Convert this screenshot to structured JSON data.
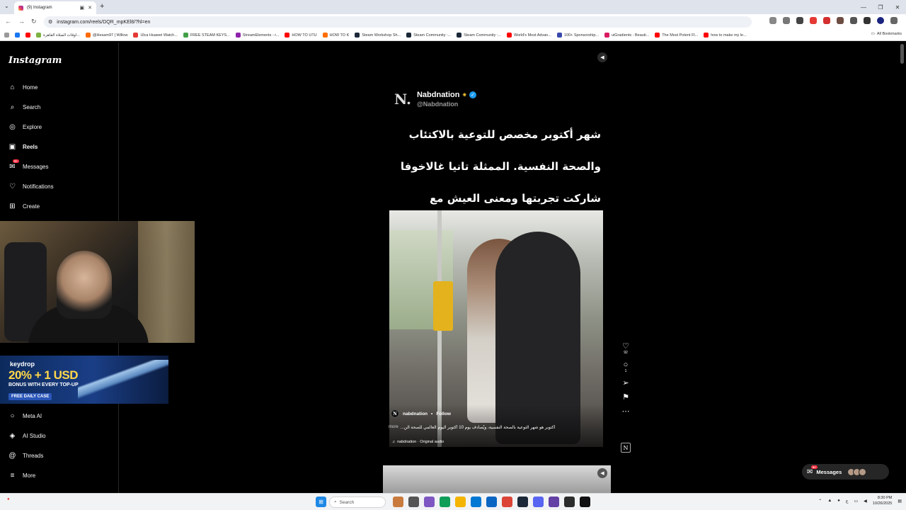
{
  "browser": {
    "tab_title": "(9) Instagram",
    "url": "instagram.com/reels/DQR_mpKEl8/?hl=en",
    "bookmarks": [
      {
        "label": "",
        "color": "#1877f2"
      },
      {
        "label": "",
        "color": "#ff0000"
      },
      {
        "label": "اوقات الصلاة القاهرة...",
        "color": "#7cb342"
      },
      {
        "label": "@Hesam97 | Willow",
        "color": "#ff6a00"
      },
      {
        "label": "Ulca Huawei Watch...",
        "color": "#e53935"
      },
      {
        "label": "FREE STEAM KEYS...",
        "color": "#43a047"
      },
      {
        "label": "StreamElements - r...",
        "color": "#8e24aa"
      },
      {
        "label": "HOW TO UTU",
        "color": "#ff0000"
      },
      {
        "label": "HOW TO K",
        "color": "#ff6f00"
      },
      {
        "label": "Steam Workshop Sh...",
        "color": "#1b2838"
      },
      {
        "label": "Steam Community :...",
        "color": "#1b2838"
      },
      {
        "label": "Steam Community :...",
        "color": "#1b2838"
      },
      {
        "label": "World's Most Advan...",
        "color": "#ff0000"
      },
      {
        "label": "100+ Sponsorship...",
        "color": "#3949ab"
      },
      {
        "label": "uiGradients - Beauti...",
        "color": "#d81b60"
      },
      {
        "label": "The Most Potent Fl...",
        "color": "#ff0000"
      },
      {
        "label": "how to make my le...",
        "color": "#ff0000"
      }
    ],
    "all_bookmarks": "All Bookmarks"
  },
  "sidebar": {
    "logo": "Instagram",
    "items": [
      {
        "label": "Home",
        "icon": "⌂",
        "name": "home"
      },
      {
        "label": "Search",
        "icon": "⌕",
        "name": "search"
      },
      {
        "label": "Explore",
        "icon": "◎",
        "name": "explore"
      },
      {
        "label": "Reels",
        "icon": "▣",
        "name": "reels"
      },
      {
        "label": "Messages",
        "icon": "✉",
        "name": "messages",
        "badge": "9+"
      },
      {
        "label": "Notifications",
        "icon": "♡",
        "name": "notifications"
      },
      {
        "label": "Create",
        "icon": "⊞",
        "name": "create"
      }
    ],
    "bottom_items": [
      {
        "label": "Meta AI",
        "icon": "○",
        "name": "meta-ai"
      },
      {
        "label": "AI Studio",
        "icon": "◈",
        "name": "ai-studio"
      },
      {
        "label": "Threads",
        "icon": "@",
        "name": "threads"
      },
      {
        "label": "More",
        "icon": "≡",
        "name": "more"
      }
    ]
  },
  "ad": {
    "brand": "keydrop",
    "headline": "20% + 1 USD",
    "subline": "BONUS WITH EVERY TOP-UP",
    "button": "FREE DAILY CASE"
  },
  "reel": {
    "tweet_logo": "N.",
    "tweet_name": "Nabdnation",
    "tweet_handle": "@Nabdnation",
    "arabic_text": "شهر أكتوبر مخصص للتوعية بالاكتئاب والصحة النفسية. الممثلة تانيا غالاخوفا شاركت تجربتها ومعنى العيش مع الاكتئاب.",
    "username": "nabdnation",
    "follow": "Follow",
    "caption": "أكتوبر هو شهر التوعية بالصحة النفسية، ويُصادف يوم 10 أكتوبر اليوم العالمي للصحة الن...",
    "caption_more": "more",
    "audio": "nabdnation · Original audio",
    "likes": "92",
    "comments": "1"
  },
  "messages_pill": {
    "label": "Messages",
    "badge": "9+"
  },
  "taskbar": {
    "search": "Search",
    "time": "8:30 PM",
    "date": "10/26/2025"
  }
}
